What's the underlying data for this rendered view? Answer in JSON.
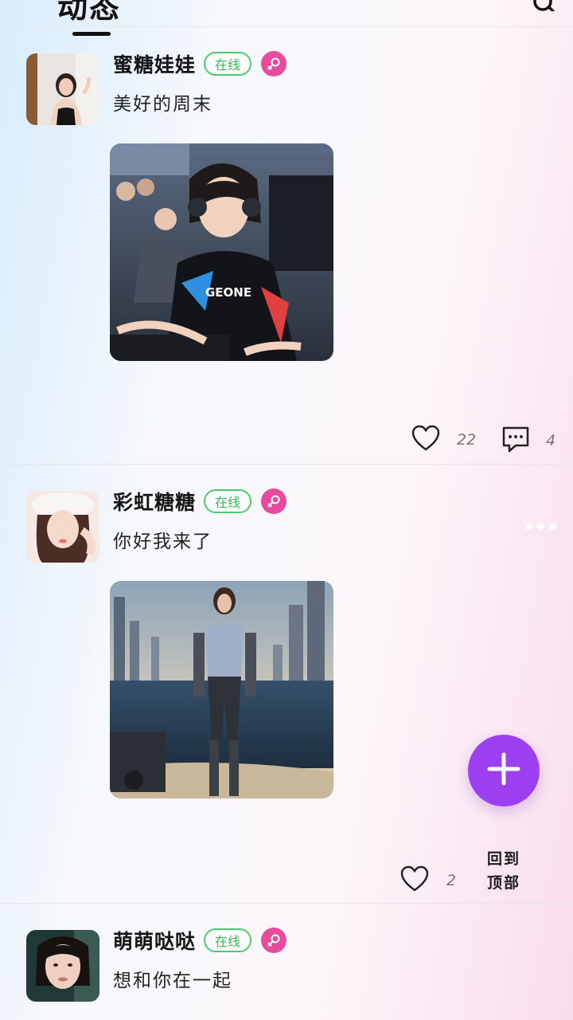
{
  "header": {
    "title": "动态",
    "search_icon": "search-icon"
  },
  "posts": [
    {
      "username": "蜜糖娃娃",
      "status": "在线",
      "gender_icon": "female-icon",
      "text": "美好的周末",
      "image": "gamer-girl-headset-photo",
      "likes": "22",
      "comments": "4"
    },
    {
      "username": "彩虹糖糖",
      "status": "在线",
      "gender_icon": "female-icon",
      "text": "你好我来了",
      "image": "robot-suit-woman-beach-photo",
      "likes": "2"
    },
    {
      "username": "萌萌哒哒",
      "status": "在线",
      "gender_icon": "female-icon",
      "text": "想和你在一起"
    }
  ],
  "fab": {
    "icon": "plus-icon"
  },
  "back_to_top": {
    "line1": "回到",
    "line2": "顶部"
  },
  "colors": {
    "online": "#4ccb6c",
    "female": "#e84a9c",
    "fab": "#9b3ff0"
  }
}
